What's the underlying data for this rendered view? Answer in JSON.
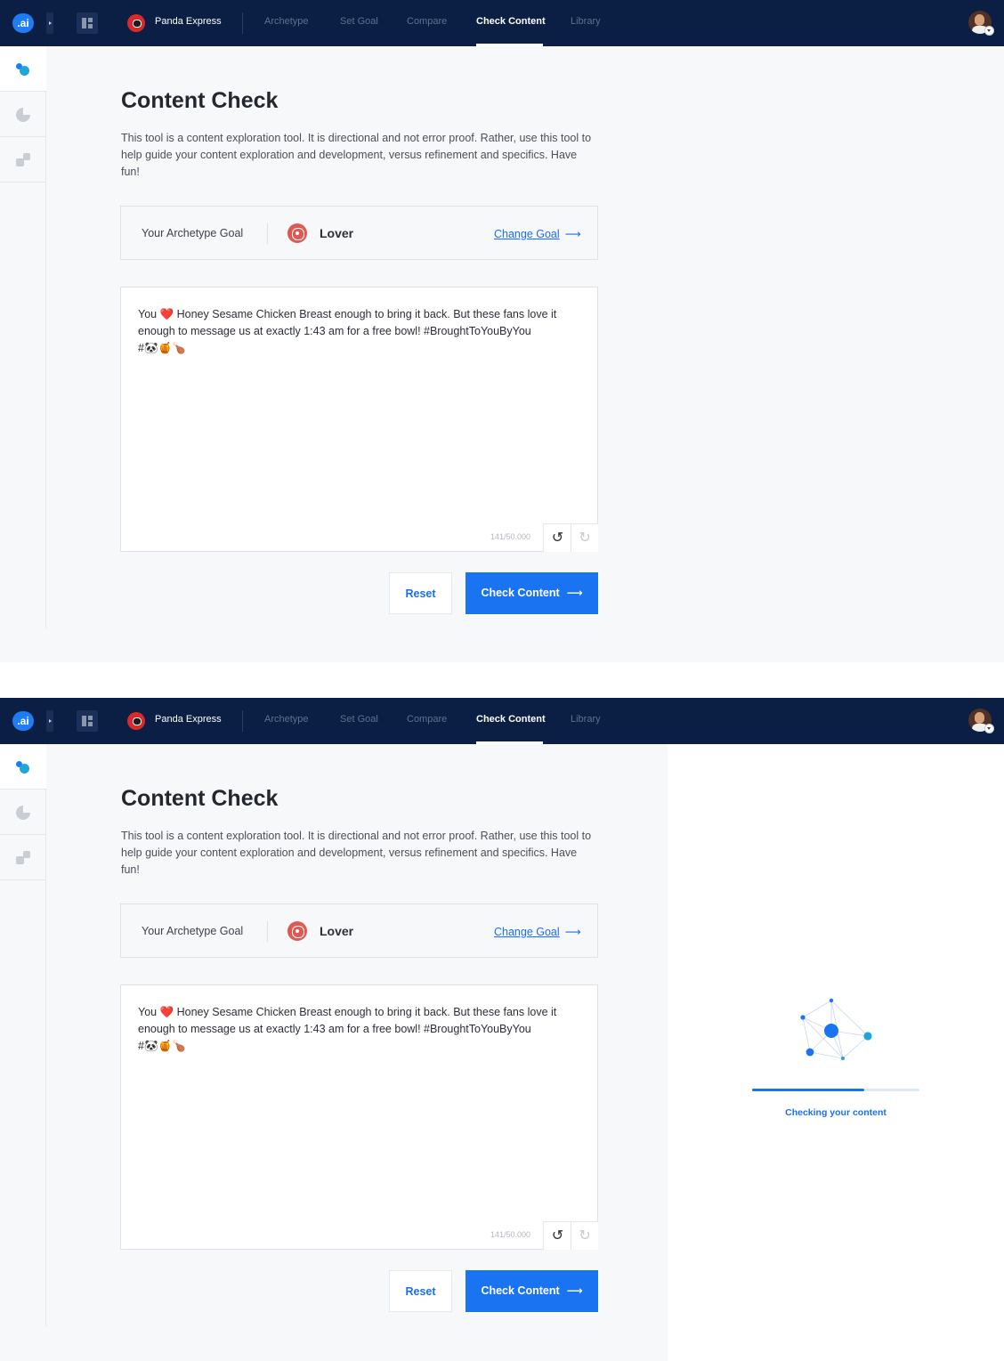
{
  "app": {
    "logo_text": ".ai",
    "brand_name": "Panda Express",
    "nav_tabs": [
      {
        "label": "Archetype",
        "active": false
      },
      {
        "label": "Set Goal",
        "active": false
      },
      {
        "label": "Compare",
        "active": false
      },
      {
        "label": "Check Content",
        "active": true
      },
      {
        "label": "Library",
        "active": false
      }
    ],
    "sidebar_icons": [
      "share-nodes-icon",
      "pie-chart-icon",
      "blocks-icon"
    ]
  },
  "content_check": {
    "title": "Content Check",
    "intro": "This tool is a content exploration tool.  It is directional and not error proof. Rather, use this tool to help guide your content exploration and development, versus refinement and specifics. Have fun!",
    "goal_label": "Your Archetype Goal",
    "goal_value": "Lover",
    "change_goal_label": "Change Goal",
    "editor": {
      "text_before_heart": "You ",
      "heart_emoji": "❤️",
      "text_after_heart": " Honey Sesame Chicken Breast enough to bring it back. But these fans love it enough to message us at exactly 1:43 am for a free bowl! #BroughtToYouByYou",
      "hashtag_line": "#🐼🍯🍗",
      "char_count": "141/50.000"
    },
    "reset_label": "Reset",
    "check_label": "Check Content",
    "arrow": "⟶"
  },
  "loading": {
    "text": "Checking your content",
    "progress": 0.67
  },
  "colors": {
    "navbar_bg": "#0b1f45",
    "accent_blue": "#1a74f2",
    "goal_icon_red": "#dc5a51"
  }
}
